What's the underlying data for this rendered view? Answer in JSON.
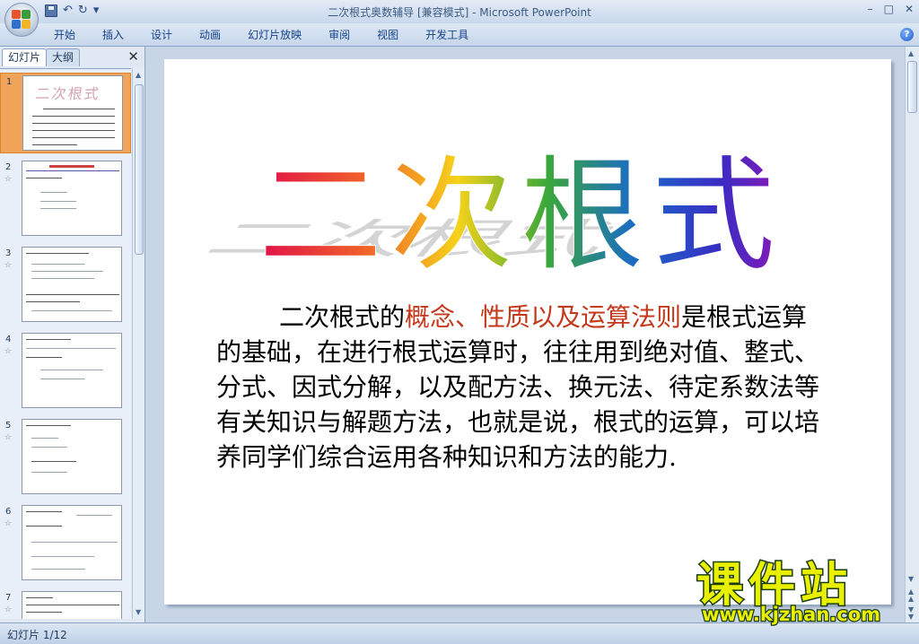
{
  "window": {
    "title": "二次根式奥数辅导 [兼容模式] - Microsoft PowerPoint",
    "controls": [
      "–",
      "□",
      "✕"
    ]
  },
  "quick_access": {
    "undo": "↶",
    "redo": "↻",
    "more": "▾"
  },
  "ribbon": {
    "tabs": [
      "开始",
      "插入",
      "设计",
      "动画",
      "幻灯片放映",
      "审阅",
      "视图",
      "开发工具"
    ],
    "help": "?"
  },
  "left_panel": {
    "tabs": [
      "幻灯片",
      "大纲"
    ],
    "close": "✕",
    "thumb1_title": "二次根式",
    "thumbnails": [
      "1",
      "2",
      "3",
      "4",
      "5",
      "6",
      "7"
    ],
    "star": "☆"
  },
  "slide": {
    "wordart": "二次根式",
    "body_prefix": "二次根式的",
    "body_highlight": "概念、性质以及运算法则",
    "body_rest": "是根式运算的基础，在进行根式运算时，往往用到绝对值、整式、分式、因式分解，以及配方法、换元法、待定系数法等有关知识与解题方法，也就是说，根式的运算，可以培养同学们综合运用各种知识和方法的能力.",
    "colors": {
      "highlight": "#c4381b"
    }
  },
  "status_bar": {
    "slide_indicator": "幻灯片 1/12"
  },
  "watermark": {
    "brand": "课件站",
    "url": "www.kjzhan.com"
  }
}
